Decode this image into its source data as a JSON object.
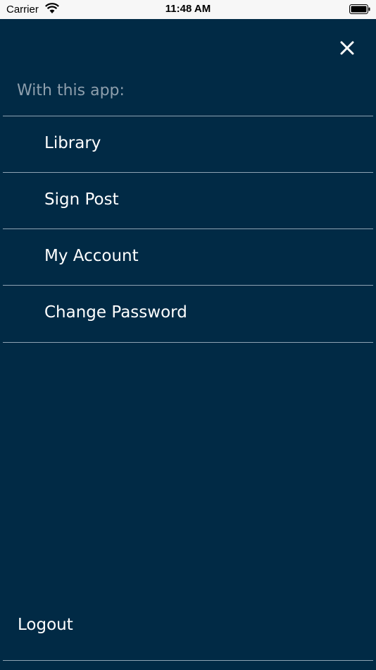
{
  "status_bar": {
    "carrier": "Carrier",
    "time": "11:48 AM",
    "icons": [
      "wifi-icon",
      "battery-icon"
    ]
  },
  "menu": {
    "close_icon": "close-icon",
    "section_label": "With this app:",
    "items": [
      {
        "label": "Library"
      },
      {
        "label": "Sign Post"
      },
      {
        "label": "My Account"
      },
      {
        "label": "Change Password"
      }
    ],
    "logout_label": "Logout"
  },
  "colors": {
    "background": "#012a45",
    "divider": "#8ea3b3",
    "text": "#ffffff",
    "muted_text": "#8e9fad"
  }
}
